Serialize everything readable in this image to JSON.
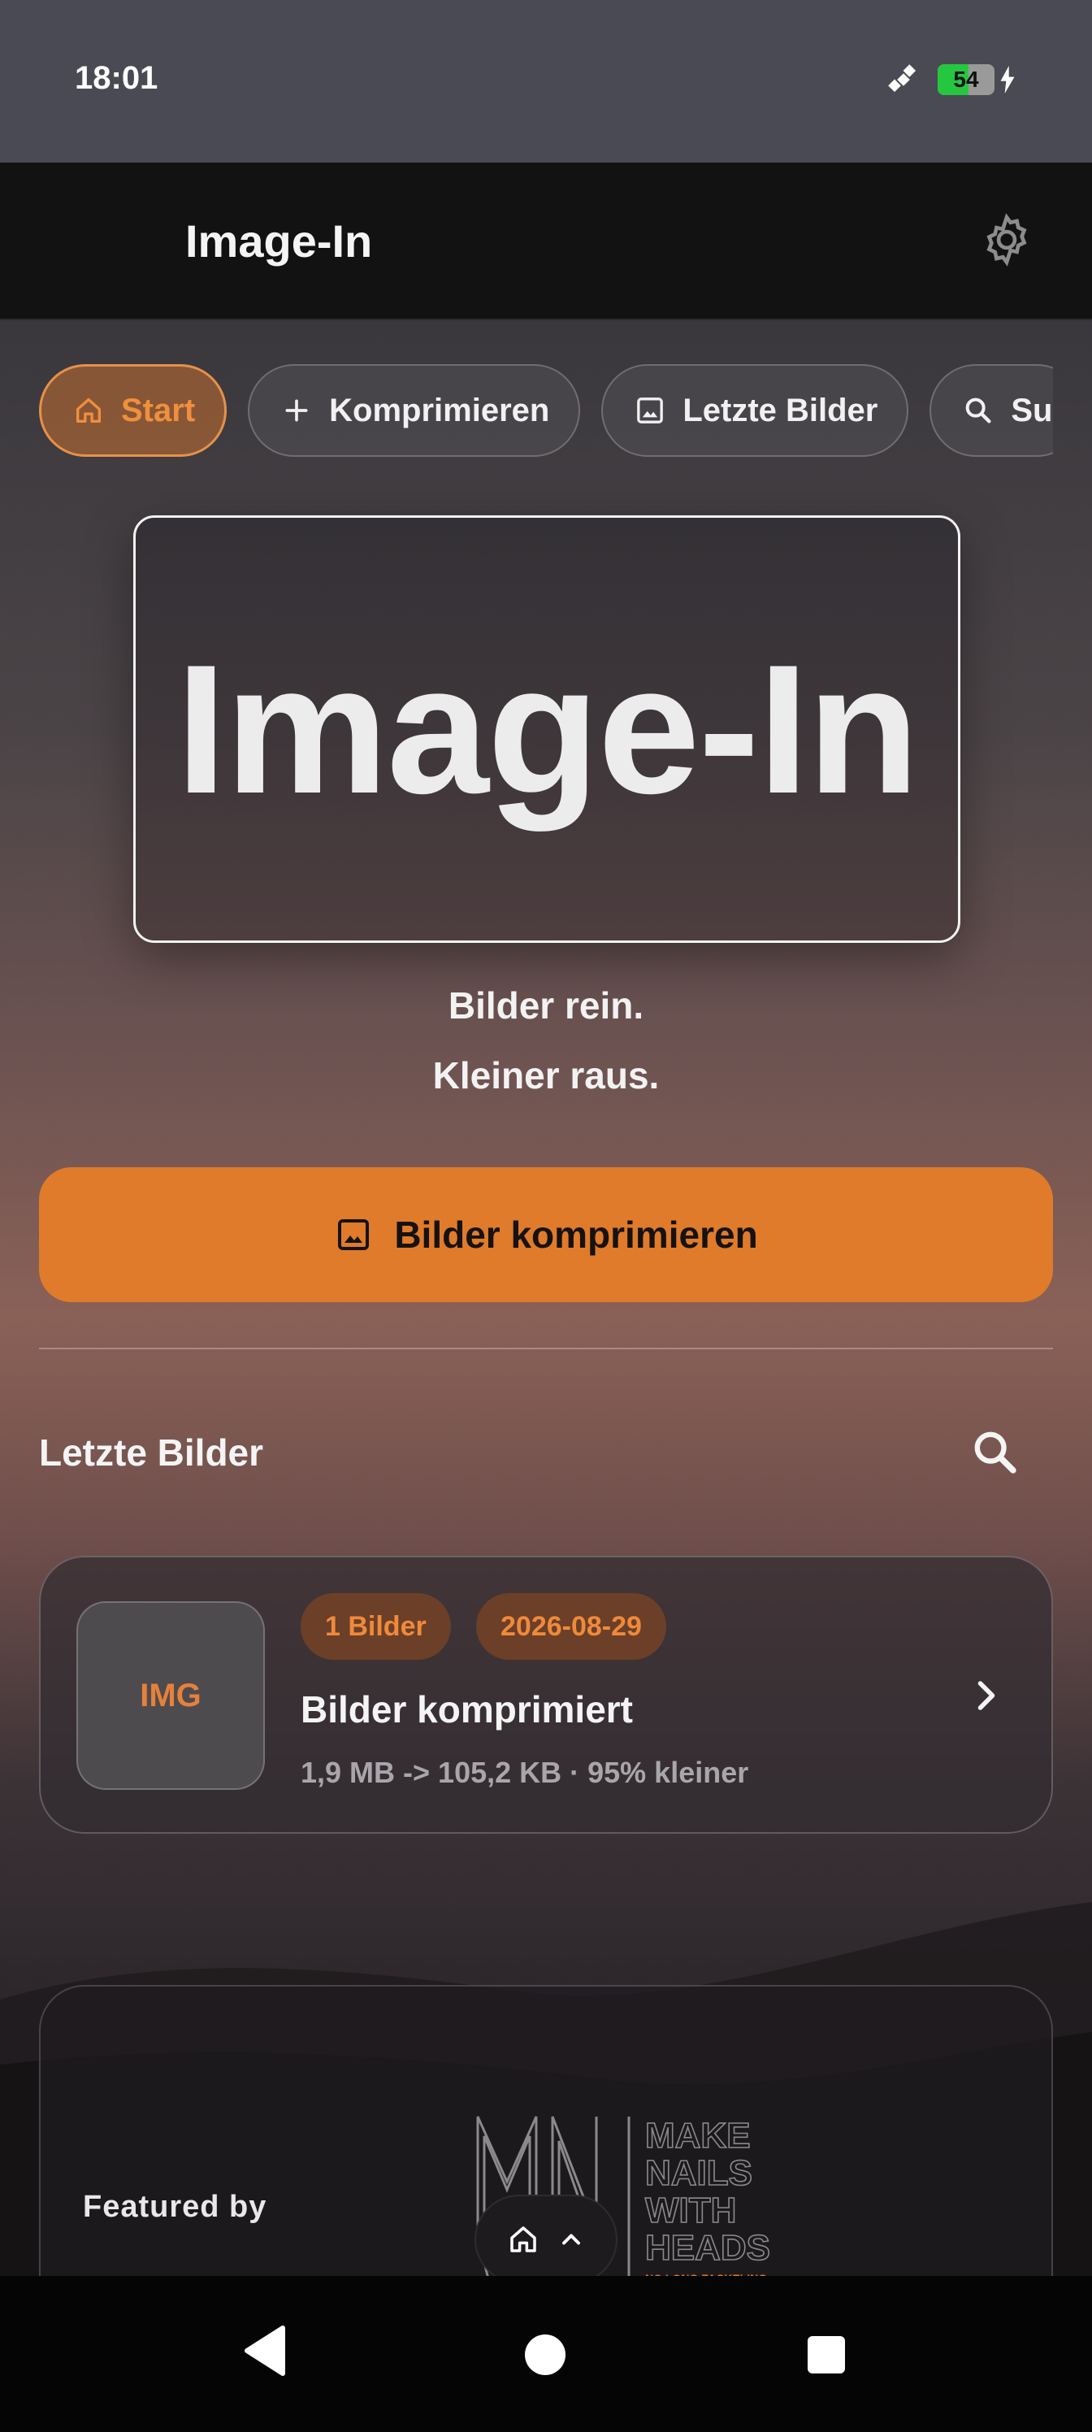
{
  "status_bar": {
    "time": "18:01",
    "battery_level": "54"
  },
  "app_bar": {
    "title": "Image-In"
  },
  "tabs": [
    {
      "label": "Start",
      "icon": "home-icon",
      "active": true
    },
    {
      "label": "Komprimieren",
      "icon": "plus-icon",
      "active": false
    },
    {
      "label": "Letzte Bilder",
      "icon": "image-icon",
      "active": false
    },
    {
      "label": "Su",
      "icon": "search-icon",
      "active": false
    }
  ],
  "hero": {
    "title": "Image-In"
  },
  "tagline": {
    "line1": "Bilder rein.",
    "line2": "Kleiner raus."
  },
  "cta": {
    "label": "Bilder komprimieren"
  },
  "recent": {
    "title": "Letzte Bilder",
    "items": [
      {
        "thumb_label": "IMG",
        "count_chip": "1 Bilder",
        "date_chip": "2026-08-29",
        "title": "Bilder komprimiert",
        "subtitle": "1,9 MB -> 105,2 KB · 95% kleiner"
      }
    ]
  },
  "featured": {
    "label": "Featured by",
    "logo_text": [
      "MAKE",
      "NAILS",
      "WITH",
      "HEADS"
    ],
    "logo_tagline": "NO LONG FACKELING."
  },
  "colors": {
    "accent": "#e07b2b",
    "background_dark": "#121212"
  }
}
